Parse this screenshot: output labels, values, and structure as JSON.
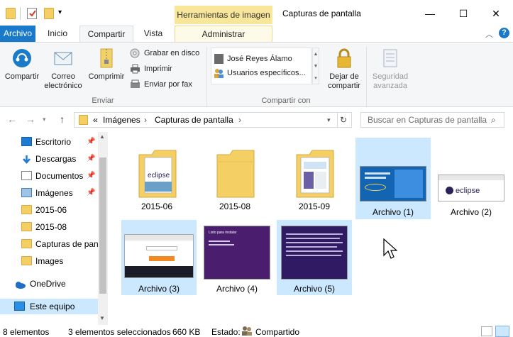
{
  "titlebar": {
    "context_tab": "Herramientas de imagen",
    "window_title": "Capturas de pantalla",
    "minimize": "—",
    "maximize": "☐",
    "close": "✕"
  },
  "tabs": {
    "file": "Archivo",
    "home": "Inicio",
    "share": "Compartir",
    "view": "Vista",
    "manage": "Administrar"
  },
  "ribbon": {
    "share_btn": "Compartir",
    "email_btn_line1": "Correo",
    "email_btn_line2": "electrónico",
    "zip_btn": "Comprimir",
    "burn_btn": "Grabar en disco",
    "print_btn": "Imprimir",
    "fax_btn": "Enviar por fax",
    "send_group": "Enviar",
    "share_with": [
      "José Reyes Álamo",
      "Usuarios específicos..."
    ],
    "stop_share_line1": "Dejar de",
    "stop_share_line2": "compartir",
    "share_group": "Compartir con",
    "security_line1": "Seguridad",
    "security_line2": "avanzada"
  },
  "address": {
    "overflow": "«",
    "crumbs": [
      "Imágenes",
      "Capturas de pantalla"
    ],
    "search_placeholder": "Buscar en Capturas de pantalla"
  },
  "nav": {
    "items": [
      {
        "label": "Escritorio",
        "icon": "desktop-icon"
      },
      {
        "label": "Descargas",
        "icon": "download-icon"
      },
      {
        "label": "Documentos",
        "icon": "documents-icon"
      },
      {
        "label": "Imágenes",
        "icon": "pictures-icon"
      },
      {
        "label": "2015-06",
        "icon": "folder-icon"
      },
      {
        "label": "2015-08",
        "icon": "folder-icon"
      },
      {
        "label": "Capturas de pan",
        "icon": "folder-icon"
      },
      {
        "label": "Images",
        "icon": "folder-icon"
      },
      {
        "label": "OneDrive",
        "icon": "cloud-icon"
      },
      {
        "label": "Este equipo",
        "icon": "computer-icon"
      }
    ]
  },
  "files": [
    {
      "label": "2015-06",
      "selected": false
    },
    {
      "label": "2015-08",
      "selected": false
    },
    {
      "label": "2015-09",
      "selected": false
    },
    {
      "label": "Archivo (1)",
      "selected": true
    },
    {
      "label": "Archivo (2)",
      "selected": false
    },
    {
      "label": "Archivo (3)",
      "selected": true
    },
    {
      "label": "Archivo (4)",
      "selected": false
    },
    {
      "label": "Archivo (5)",
      "selected": true
    }
  ],
  "thumb_text": {
    "eclipse": "eclipse",
    "purple_title": "Listo para instalar"
  },
  "status": {
    "count": "8 elementos",
    "selection": "3 elementos seleccionados",
    "size": "660 KB",
    "state_label": "Estado:",
    "state_value": "Compartido"
  },
  "colors": {
    "accent": "#1979ca",
    "selection": "#cce8ff",
    "folder": "#f4cf63",
    "context_tab": "#f8e79a"
  }
}
